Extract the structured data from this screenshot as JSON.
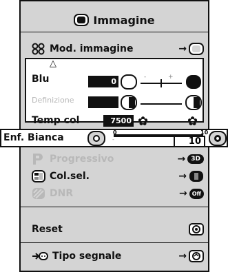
{
  "title": "Immagine",
  "menu": {
    "mod_immagine": "Mod. immagine",
    "blu": {
      "label": "Blu",
      "value": "0"
    },
    "definizione": {
      "label": "Definizione"
    },
    "temp_col": {
      "label": "Temp col",
      "value": "7500"
    },
    "enf_bianca": {
      "label": "Enf. Bianca",
      "min": "0",
      "max": "10",
      "value": "10",
      "level": 1.0
    },
    "progressivo": {
      "label": "Progressivo",
      "badge": "3D"
    },
    "col_sel": {
      "label": "Col.sel."
    },
    "dnr": {
      "label": "DNR",
      "badge": "Off"
    },
    "reset": {
      "label": "Reset"
    },
    "tipo_segnale": {
      "label": "Tipo segnale"
    }
  },
  "arrow": "→",
  "minus": "-",
  "plus": "+",
  "triangle_up": "△"
}
